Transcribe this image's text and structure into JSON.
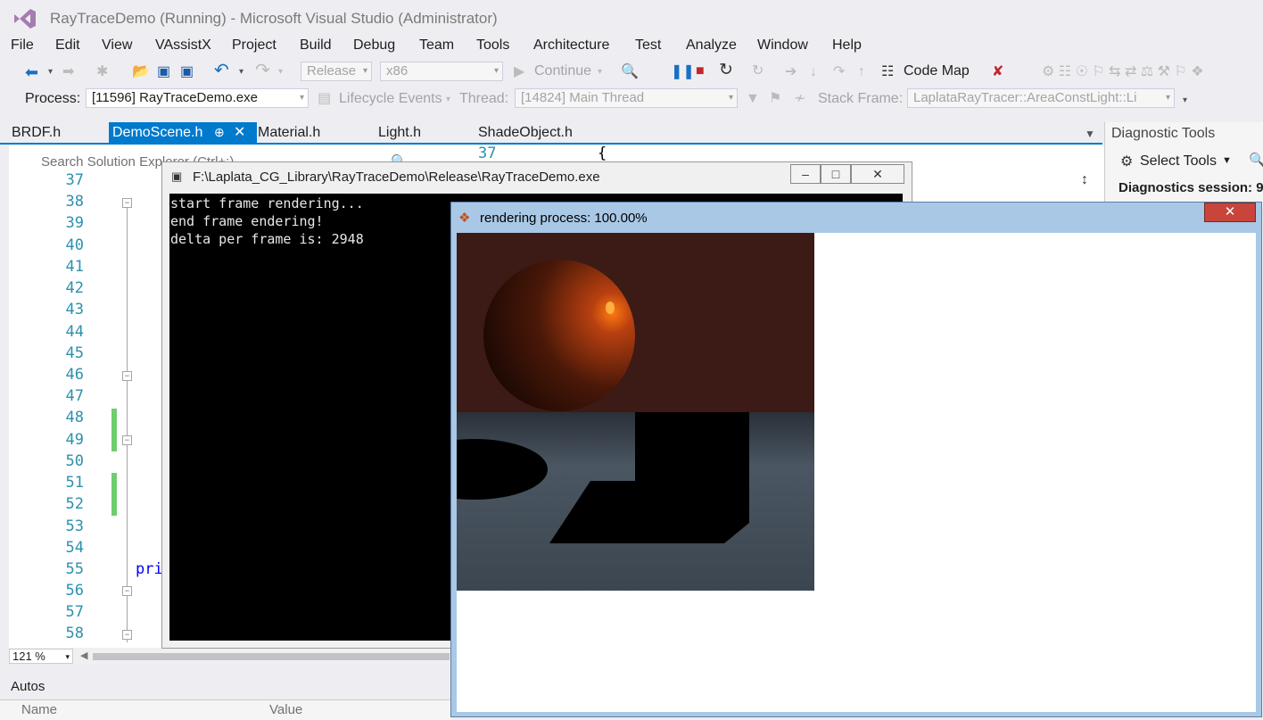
{
  "titlebar": {
    "title": "RayTraceDemo (Running) - Microsoft Visual Studio (Administrator)"
  },
  "menu": [
    "File",
    "Edit",
    "View",
    "VAssistX",
    "Project",
    "Build",
    "Debug",
    "Team",
    "Tools",
    "Architecture",
    "Test",
    "Analyze",
    "Window",
    "Help"
  ],
  "toolbar": {
    "config": "Release",
    "platform": "x86",
    "continue_label": "Continue",
    "code_map_label": "Code Map"
  },
  "debug_location": {
    "process_label": "Process:",
    "process_value": "[11596] RayTraceDemo.exe",
    "lifecycle_label": "Lifecycle Events",
    "thread_label": "Thread:",
    "thread_value": "[14824] Main Thread",
    "stack_frame_label": "Stack Frame:",
    "stack_frame_value": "LaplataRayTracer::AreaConstLight::Li"
  },
  "tabs": [
    "BRDF.h",
    "DemoScene.h",
    "Material.h",
    "Light.h",
    "ShadeObject.h"
  ],
  "solution_search_placeholder": "Search Solution Explorer (Ctrl+;)",
  "editor": {
    "line_numbers": [
      "37",
      "38",
      "39",
      "40",
      "41",
      "42",
      "43",
      "44",
      "45",
      "46",
      "47",
      "48",
      "49",
      "50",
      "51",
      "52",
      "53",
      "54",
      "55",
      "56",
      "57",
      "58"
    ],
    "code_fragment": "pri",
    "second_pane_line": "37",
    "second_pane_code": "{"
  },
  "zoom": "121 %",
  "diagnostics": {
    "title": "Diagnostic Tools",
    "select_tools": "Select Tools",
    "session": "Diagnostics session: 9"
  },
  "autos": {
    "title": "Autos",
    "col_name": "Name",
    "col_value": "Value"
  },
  "console": {
    "title": "F:\\Laplata_CG_Library\\RayTraceDemo\\Release\\RayTraceDemo.exe",
    "lines": [
      "start frame rendering...",
      "end frame endering!",
      "delta per frame is: 2948"
    ]
  },
  "render_window": {
    "title": "rendering process: 100.00%"
  },
  "colors": {
    "accent": "#007acc",
    "change_marker": "#6ecd6e",
    "line_number": "#2b91af"
  }
}
